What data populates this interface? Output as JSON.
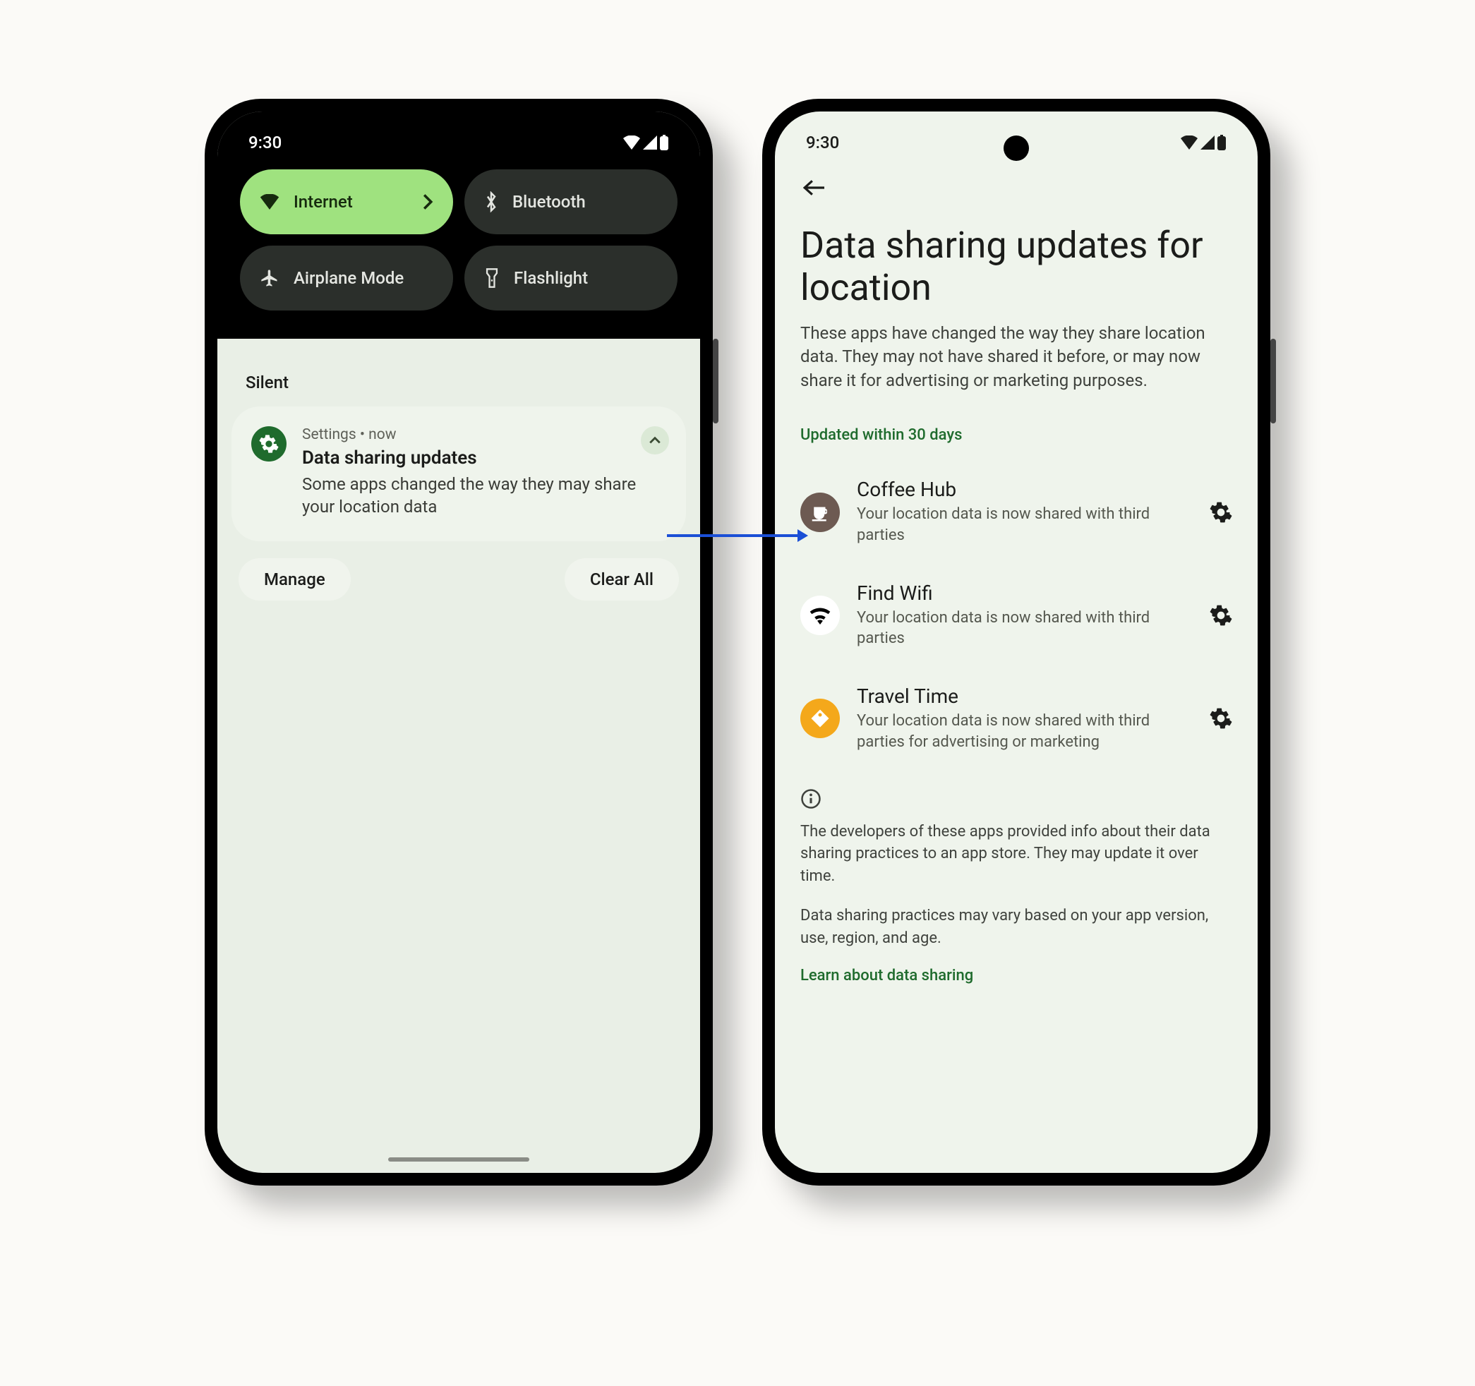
{
  "statusbar": {
    "time": "9:30"
  },
  "quicksettings": {
    "internet": "Internet",
    "bluetooth": "Bluetooth",
    "airplane": "Airplane Mode",
    "flashlight": "Flashlight"
  },
  "shade": {
    "silent_label": "Silent",
    "notif_source": "Settings  •  now",
    "notif_title": "Data sharing updates",
    "notif_text": "Some apps changed the way they may share your location data",
    "manage": "Manage",
    "clear_all": "Clear All"
  },
  "detail": {
    "title": "Data sharing updates for location",
    "subtitle": "These apps have changed the way they share location data. They may not have shared it before, or may now share it for advertising or marketing purposes.",
    "section_label": "Updated within 30 days",
    "apps": [
      {
        "name": "Coffee Hub",
        "desc": "Your location data is now shared with third parties",
        "icon_bg": "#6d5a52",
        "icon_fg": "#fff",
        "icon": "coffee"
      },
      {
        "name": "Find Wifi",
        "desc": "Your location data is now shared with third parties",
        "icon_bg": "#ffffff",
        "icon_fg": "#000",
        "icon": "wifi"
      },
      {
        "name": "Travel Time",
        "desc": "Your location data is now shared with third parties for advertising or marketing",
        "icon_bg": "#f4a81b",
        "icon_fg": "#fff",
        "icon": "tag"
      }
    ],
    "footer1": "The developers of these apps provided info about their data sharing practices to an app store. They may update it over time.",
    "footer2": "Data sharing practices may vary based on your app version, use, region, and age.",
    "learn_link": "Learn about data sharing"
  }
}
